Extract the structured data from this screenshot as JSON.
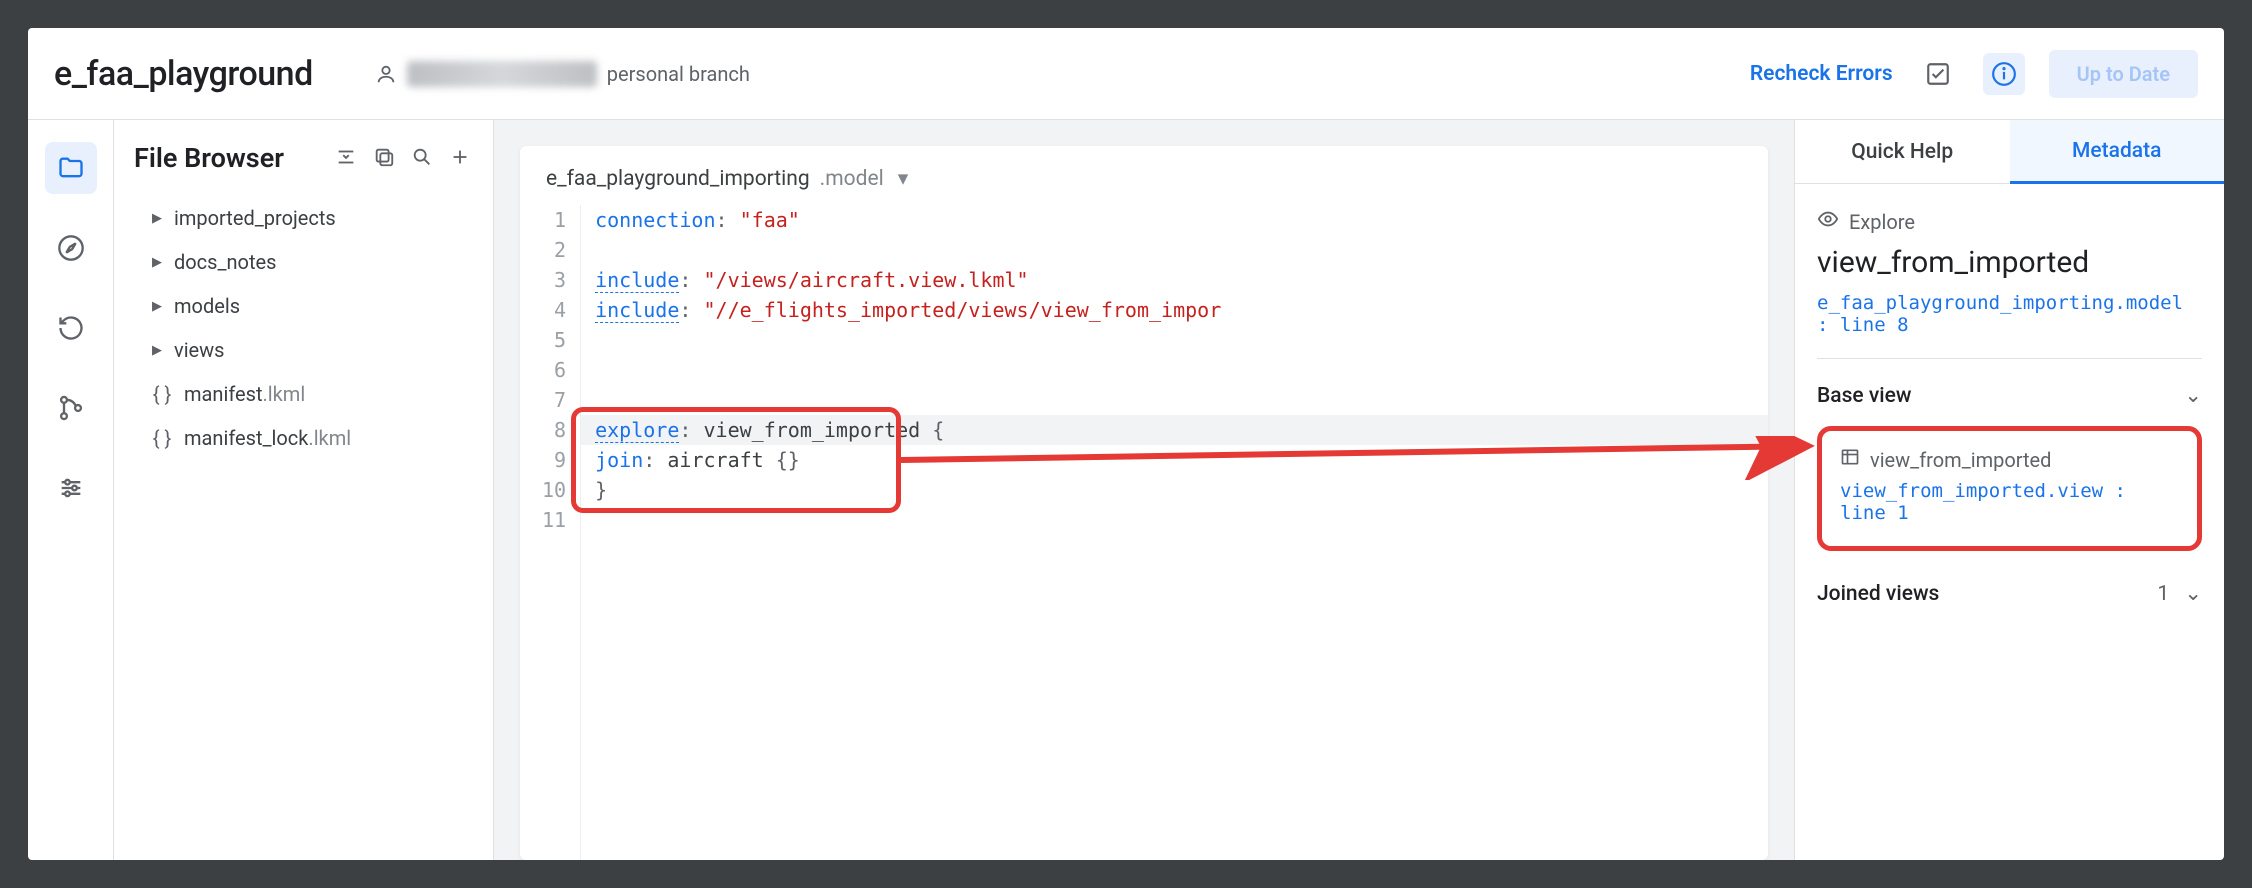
{
  "header": {
    "project_title": "e_faa_playground",
    "branch_label": "personal branch",
    "recheck_label": "Recheck Errors",
    "uptodate_label": "Up to Date"
  },
  "sidebar": {
    "title": "File Browser",
    "tree": [
      {
        "type": "folder",
        "label": "imported_projects"
      },
      {
        "type": "folder",
        "label": "docs_notes"
      },
      {
        "type": "folder",
        "label": "models"
      },
      {
        "type": "folder",
        "label": "views"
      },
      {
        "type": "file",
        "label": "manifest",
        "ext": ".lkml"
      },
      {
        "type": "file",
        "label": "manifest_lock",
        "ext": ".lkml"
      }
    ]
  },
  "editor": {
    "file_name": "e_faa_playground_importing",
    "file_ext": ".model",
    "lines": [
      {
        "n": 1,
        "tokens": [
          [
            "key",
            "connection"
          ],
          [
            "pun",
            ": "
          ],
          [
            "str",
            "\"faa\""
          ]
        ]
      },
      {
        "n": 2,
        "tokens": []
      },
      {
        "n": 3,
        "tokens": [
          [
            "key dotted",
            "include"
          ],
          [
            "pun",
            ": "
          ],
          [
            "str",
            "\"/views/aircraft.view.lkml\""
          ]
        ]
      },
      {
        "n": 4,
        "tokens": [
          [
            "key dotted",
            "include"
          ],
          [
            "pun",
            ": "
          ],
          [
            "str",
            "\"//e_flights_imported/views/view_from_impor"
          ]
        ]
      },
      {
        "n": 5,
        "tokens": []
      },
      {
        "n": 6,
        "tokens": []
      },
      {
        "n": 7,
        "tokens": []
      },
      {
        "n": 8,
        "hl": true,
        "fold": true,
        "tokens": [
          [
            "key dotted",
            "explore"
          ],
          [
            "pun",
            ": "
          ],
          [
            "id",
            "view_from_imported "
          ],
          [
            "pun",
            "{"
          ]
        ]
      },
      {
        "n": 9,
        "tokens": [
          [
            "pun",
            "  "
          ],
          [
            "key",
            "join"
          ],
          [
            "pun",
            ": "
          ],
          [
            "id",
            "aircraft "
          ],
          [
            "pun",
            "{}"
          ]
        ]
      },
      {
        "n": 10,
        "tokens": [
          [
            "pun",
            "}"
          ]
        ]
      },
      {
        "n": 11,
        "tokens": []
      }
    ]
  },
  "rightpane": {
    "tabs": {
      "quick_help": "Quick Help",
      "metadata": "Metadata"
    },
    "kind": "Explore",
    "name": "view_from_imported",
    "location": "e_faa_playground_importing.model : line 8",
    "base_view": {
      "heading": "Base view",
      "name": "view_from_imported",
      "link": "view_from_imported.view : line 1"
    },
    "joined_views": {
      "heading": "Joined views",
      "count": "1"
    }
  }
}
